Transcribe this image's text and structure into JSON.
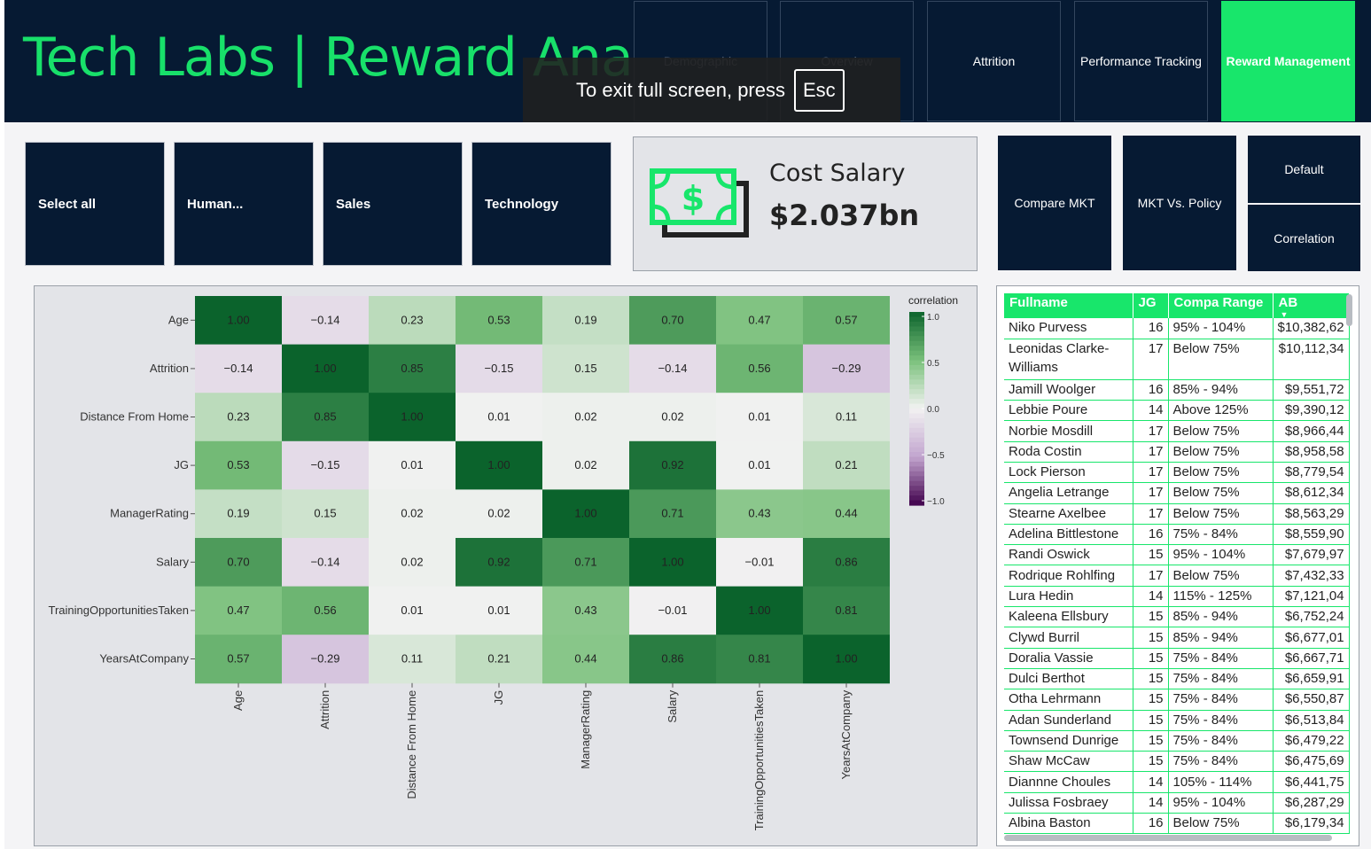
{
  "header": {
    "title": "Tech Labs | Reward Analysis",
    "nav": [
      "Demographic",
      "Overview",
      "Attrition",
      "Performance Tracking",
      "Reward Management"
    ],
    "active_nav": "Reward Management"
  },
  "fullscreen_toast": {
    "text": "To exit full screen, press",
    "key": "Esc"
  },
  "filters": [
    "Select all",
    "Human...",
    "Sales",
    "Technology"
  ],
  "kpi": {
    "icon": "money-icon",
    "label": "Cost Salary",
    "value": "$2.037bn"
  },
  "right_buttons": {
    "compare": "Compare MKT",
    "mkt_policy": "MKT Vs. Policy",
    "default": "Default",
    "correlation": "Correlation"
  },
  "colors": {
    "navy": "#061a33",
    "accent": "#18e66b",
    "panel": "#e3e4e8",
    "pos": "#0b6b2e",
    "neg": "#7b1b78"
  },
  "chart_data": {
    "type": "heatmap",
    "variables": [
      "Age",
      "Attrition",
      "Distance From Home",
      "JG",
      "ManagerRating",
      "Salary",
      "TrainingOpportunitiesTaken",
      "YearsAtCompany"
    ],
    "matrix": [
      [
        1.0,
        -0.14,
        0.23,
        0.53,
        0.19,
        0.7,
        0.47,
        0.57
      ],
      [
        -0.14,
        1.0,
        0.85,
        -0.15,
        0.15,
        -0.14,
        0.56,
        -0.29
      ],
      [
        0.23,
        0.85,
        1.0,
        0.01,
        0.02,
        0.02,
        0.01,
        0.11
      ],
      [
        0.53,
        -0.15,
        0.01,
        1.0,
        0.02,
        0.92,
        0.01,
        0.21
      ],
      [
        0.19,
        0.15,
        0.02,
        0.02,
        1.0,
        0.71,
        0.43,
        0.44
      ],
      [
        0.7,
        -0.14,
        0.02,
        0.92,
        0.71,
        1.0,
        -0.01,
        0.86
      ],
      [
        0.47,
        0.56,
        0.01,
        0.01,
        0.43,
        -0.01,
        1.0,
        0.81
      ],
      [
        0.57,
        -0.29,
        0.11,
        0.21,
        0.44,
        0.86,
        0.81,
        1.0
      ]
    ],
    "colorbar": {
      "title": "correlation",
      "ticks": [
        "1.0",
        "0.5",
        "0.0",
        "−0.5",
        "−1.0"
      ],
      "range": [
        -1,
        1
      ]
    }
  },
  "table": {
    "columns": [
      "Fullname",
      "JG",
      "Compa Range",
      "AB"
    ],
    "rows": [
      [
        "Niko Purvess",
        "16",
        "95% - 104%",
        "$10,382,62"
      ],
      [
        "Leonidas Clarke-Williams",
        "17",
        "Below 75%",
        "$10,112,34"
      ],
      [
        "Jamill Woolger",
        "16",
        "85% - 94%",
        "$9,551,72"
      ],
      [
        "Lebbie Poure",
        "14",
        "Above 125%",
        "$9,390,12"
      ],
      [
        "Norbie Mosdill",
        "17",
        "Below 75%",
        "$8,966,44"
      ],
      [
        "Roda Costin",
        "17",
        "Below 75%",
        "$8,958,58"
      ],
      [
        "Lock Pierson",
        "17",
        "Below 75%",
        "$8,779,54"
      ],
      [
        "Angelia Letrange",
        "17",
        "Below 75%",
        "$8,612,34"
      ],
      [
        "Stearne Axelbee",
        "17",
        "Below 75%",
        "$8,563,29"
      ],
      [
        "Adelina Bittlestone",
        "16",
        "75% - 84%",
        "$8,559,90"
      ],
      [
        "Randi Oswick",
        "15",
        "95% - 104%",
        "$7,679,97"
      ],
      [
        "Rodrique Rohlfing",
        "17",
        "Below 75%",
        "$7,432,33"
      ],
      [
        "Lura Hedin",
        "14",
        "115% - 125%",
        "$7,121,04"
      ],
      [
        "Kaleena Ellsbury",
        "15",
        "85% - 94%",
        "$6,752,24"
      ],
      [
        "Clywd Burril",
        "15",
        "85% - 94%",
        "$6,677,01"
      ],
      [
        "Doralia Vassie",
        "15",
        "75% - 84%",
        "$6,667,71"
      ],
      [
        "Dulci Berthot",
        "15",
        "75% - 84%",
        "$6,659,91"
      ],
      [
        "Otha Lehrmann",
        "15",
        "75% - 84%",
        "$6,550,87"
      ],
      [
        "Adan Sunderland",
        "15",
        "75% - 84%",
        "$6,513,84"
      ],
      [
        "Townsend Dunrige",
        "15",
        "75% - 84%",
        "$6,479,22"
      ],
      [
        "Shaw McCaw",
        "15",
        "75% - 84%",
        "$6,475,69"
      ],
      [
        "Diannne Choules",
        "14",
        "105% - 114%",
        "$6,441,75"
      ],
      [
        "Julissa Fosbraey",
        "14",
        "95% - 104%",
        "$6,287,29"
      ],
      [
        "Albina Baston",
        "16",
        "Below 75%",
        "$6,179,34"
      ]
    ]
  }
}
